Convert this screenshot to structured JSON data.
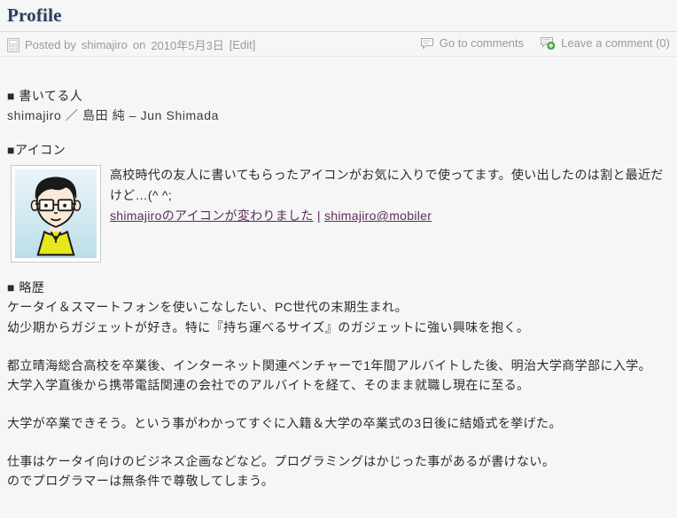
{
  "post": {
    "title": "Profile",
    "meta": {
      "posted_prefix": "Posted by",
      "author": "shimajiro",
      "on_word": "on",
      "date": "2010年5月3日",
      "edit_label": "[Edit]",
      "goto_comments": "Go to comments",
      "leave_comment": "Leave a comment (0)",
      "post_icon": "document-icon",
      "comment_icon": "comment-bubble-icon",
      "leave_comment_icon": "comment-bubble-plus-icon"
    }
  },
  "sections": {
    "author": {
      "heading": "■ 書いてる人",
      "byline": "shimajiro ／ 島田 純 – Jun Shimada"
    },
    "icon": {
      "heading": "■アイコン",
      "avatar_alt": "avatar-cartoon-portrait",
      "paragraph_line1": "高校時代の友人に書いてもらったアイコンがお気に入りで使ってます。使い出したのは割と最近だ",
      "paragraph_line2": "けど…(^ ^;",
      "link_text": "shimajiroのアイコンが変わりました",
      "link_separator": "|",
      "link_suffix": "shimajiro@mobiler"
    },
    "bio": {
      "heading": "■ 略歴",
      "lines": [
        "ケータイ＆スマートフォンを使いこなしたい、PC世代の末期生まれ。",
        "幼少期からガジェットが好き。特に『持ち運べるサイズ』のガジェットに強い興味を抱く。",
        "都立晴海総合高校を卒業後、インターネット関連ベンチャーで1年間アルバイトした後、明治大学商学部に入学。",
        "大学入学直後から携帯電話関連の会社でのアルバイトを経て、そのまま就職し現在に至る。",
        "大学が卒業できそう。という事がわかってすぐに入籍＆大学の卒業式の3日後に結婚式を挙げた。",
        "仕事はケータイ向けのビジネス企画などなど。プログラミングはかじった事があるが書けない。",
        "のでプログラマーは無条件で尊敬してしまう。"
      ]
    }
  },
  "colors": {
    "page_background": "#f6f6f6",
    "title": "#2a3f5f",
    "meta_text": "#9a9a9a",
    "body_text": "#2b2b2b",
    "visited_link": "#5a2d5c",
    "rule": "#dcdcdc"
  }
}
